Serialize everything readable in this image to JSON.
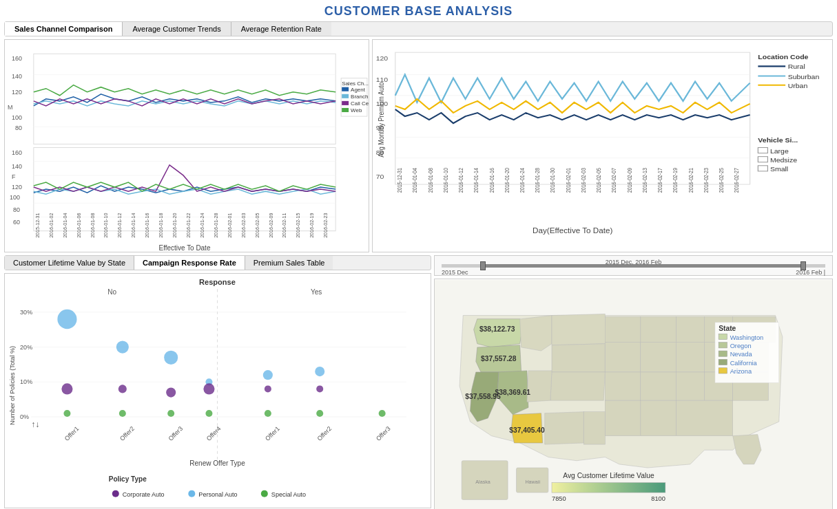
{
  "page": {
    "title": "CUSTOMER BASE ANALYSIS"
  },
  "top_tabs": [
    {
      "label": "Sales Channel Comparison",
      "active": true
    },
    {
      "label": "Average Customer Trends",
      "active": false
    },
    {
      "label": "Average Retention Rate",
      "active": false
    }
  ],
  "left_chart": {
    "title": "Sales Channel Comparison",
    "y_label_top": "M",
    "y_label_bottom": "F",
    "x_label": "Effective To Date",
    "y_max": 160,
    "y_mid": 120,
    "y_low": 80,
    "legend_title": "Sales Ch...",
    "legend_items": [
      {
        "label": "Agent",
        "color": "#1f5fa6"
      },
      {
        "label": "Branch",
        "color": "#6bb8d9"
      },
      {
        "label": "Call Ce...",
        "color": "#7b2d8b"
      },
      {
        "label": "Web",
        "color": "#4aaa44"
      }
    ]
  },
  "right_chart": {
    "title": "Average Customer Trends",
    "y_label": "Avg Monthly Premium Auto",
    "x_label": "Day(Effective To Date)",
    "y_max": 120,
    "y_mid": 100,
    "y_min": 80,
    "y_low": 70,
    "legend_title": "Location Code",
    "legend_items": [
      {
        "label": "Rural",
        "color": "#1a3d6b"
      },
      {
        "label": "Suburban",
        "color": "#6bb8d9"
      },
      {
        "label": "Urban",
        "color": "#f0b800"
      }
    ],
    "vehicle_legend_title": "Vehicle Si...",
    "vehicle_legend_items": [
      {
        "label": "Large",
        "color": "#fff"
      },
      {
        "label": "Medsize",
        "color": "#fff"
      },
      {
        "label": "Small",
        "color": "#fff"
      }
    ]
  },
  "bottom_tabs": [
    {
      "label": "Customer Lifetime Value by State",
      "active": false
    },
    {
      "label": "Campaign Response Rate",
      "active": true
    },
    {
      "label": "Premium Sales Table",
      "active": false
    }
  ],
  "slider": {
    "title": "2015 Dec. 2016 Feb",
    "left_label": "2015 Dec",
    "right_label": "2016 Feb |"
  },
  "scatter_chart": {
    "title": "Response",
    "no_label": "No",
    "yes_label": "Yes",
    "y_label": "Number of Policies (Total %)",
    "x_label": "Renew Offer Type",
    "y_ticks": [
      "30%",
      "20%",
      "10%",
      "0%"
    ],
    "policy_legend_title": "Policy Type",
    "policy_types": [
      {
        "label": "Corporate Auto",
        "color": "#6b2d8b"
      },
      {
        "label": "Personal Auto",
        "color": "#6bb8e8"
      },
      {
        "label": "Special Auto",
        "color": "#4aaa44"
      }
    ],
    "offer_types_no": [
      "Offer1",
      "Offer2",
      "Offer3",
      "Offer4"
    ],
    "offer_types_yes": [
      "Offer1",
      "Offer2",
      "Offer3"
    ]
  },
  "map": {
    "state_values": [
      {
        "state": "Washington",
        "value": "$38,122.73",
        "x": 14,
        "y": 17
      },
      {
        "state": "Oregon",
        "value": "$37,557.28",
        "x": 8,
        "y": 28
      },
      {
        "state": "Nevada",
        "value": "$38,369.61",
        "x": 18,
        "y": 43
      },
      {
        "state": "California",
        "value": "$37,558.95",
        "x": 7,
        "y": 55
      },
      {
        "state": "Arizona",
        "value": "$37,405.40",
        "x": 26,
        "y": 62
      }
    ],
    "color_bar": {
      "title": "Avg Customer Lifetime Value",
      "min": "7850",
      "max": "8100"
    },
    "state_legend": {
      "title": "State",
      "items": [
        {
          "label": "Washington",
          "color": "#c8d8a8"
        },
        {
          "label": "Oregon",
          "color": "#b8c898"
        },
        {
          "label": "Nevada",
          "color": "#a8ba88"
        },
        {
          "label": "California",
          "color": "#98aa78"
        },
        {
          "label": "Arizona",
          "color": "#e8c840"
        }
      ]
    }
  }
}
